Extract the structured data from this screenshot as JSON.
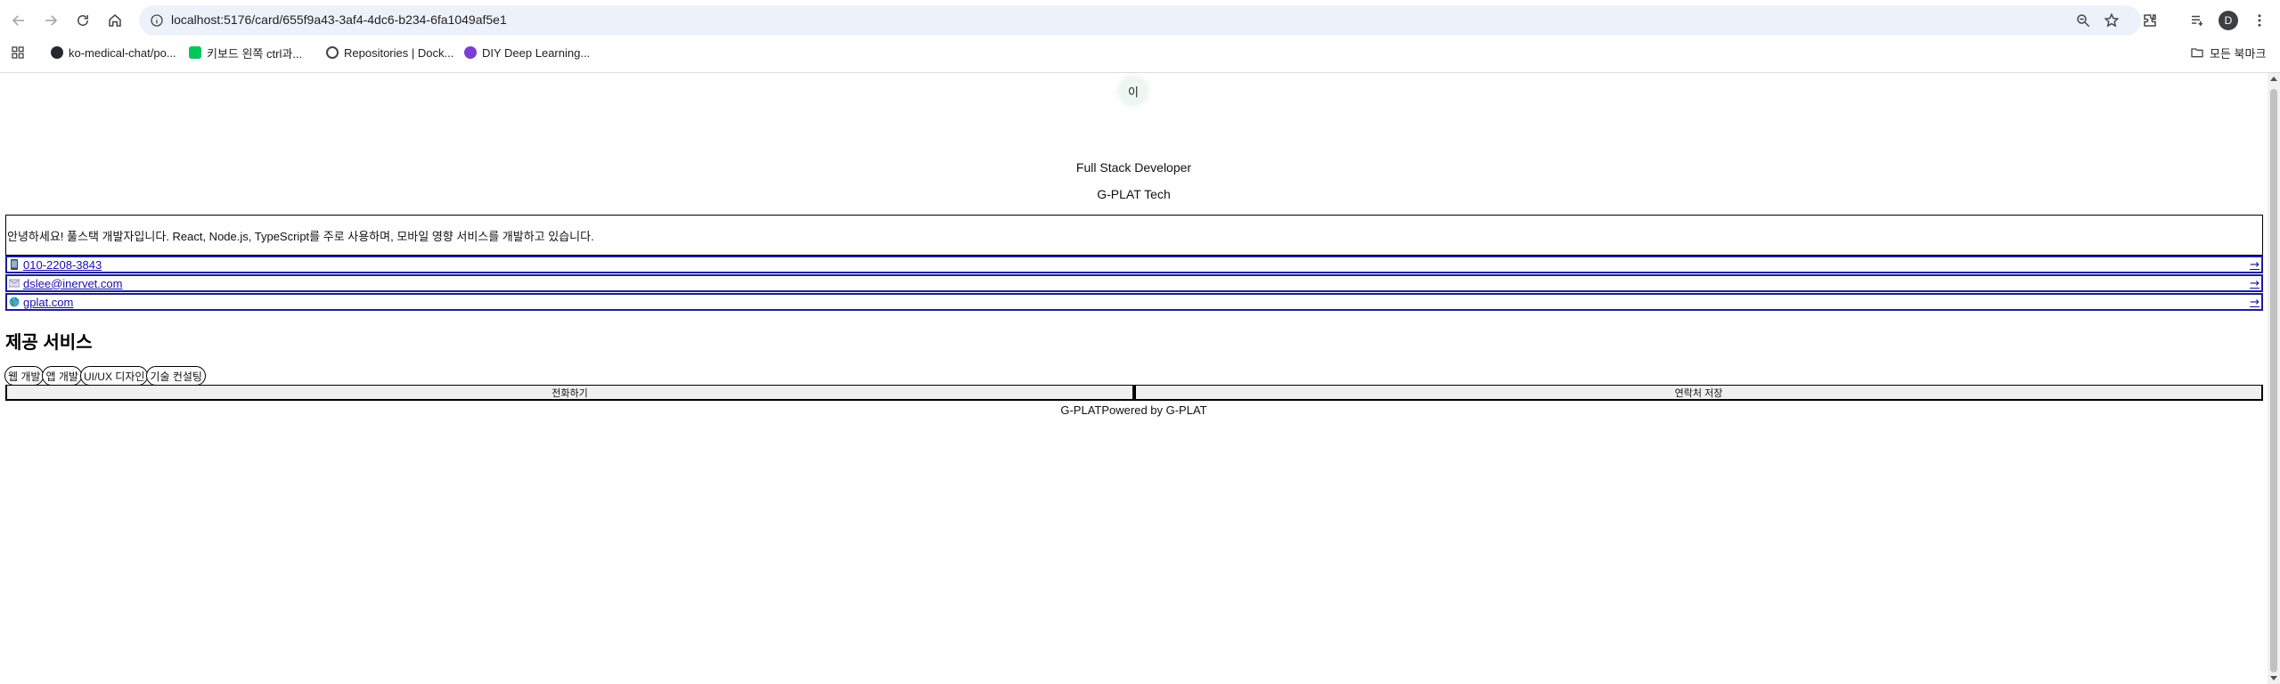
{
  "browser": {
    "url": "localhost:5176/card/655f9a43-3af4-4dc6-b234-6fa1049af5e1",
    "profile_initial": "D",
    "bookmarks": [
      {
        "label": "ko-medical-chat/po...",
        "icon": "github-icon",
        "color": "#24292f"
      },
      {
        "label": "키보드 왼쪽 ctrl과...",
        "icon": "naver-talk-icon",
        "color": "#03c75a"
      },
      {
        "label": "Repositories | Dock...",
        "icon": "docker-icon",
        "color": "#1d63ed"
      },
      {
        "label": "DIY Deep Learning...",
        "icon": "caffe-icon",
        "color": "#7b3fd0"
      }
    ],
    "all_bookmarks_label": "모든 북마크"
  },
  "card": {
    "avatar_initial": "이",
    "job_title": "Full Stack Developer",
    "company": "G-PLAT Tech",
    "intro": "안녕하세요! 풀스택 개발자입니다. React, Node.js, TypeScript를 주로 사용하며, 모바일 영향 서비스를 개발하고 있습니다.",
    "contacts": [
      {
        "type": "phone",
        "icon": "phone-icon",
        "text": "010-2208-3843",
        "arrow": "→"
      },
      {
        "type": "email",
        "icon": "email-icon",
        "text": "dslee@inervet.com",
        "arrow": "→"
      },
      {
        "type": "website",
        "icon": "globe-icon",
        "text": "gplat.com",
        "arrow": "→"
      }
    ],
    "services_title": "제공 서비스",
    "services": [
      "웹 개발",
      "앱 개발",
      "UI/UX 디자인",
      "기술 컨설팅"
    ],
    "actions": {
      "call": "전화하기",
      "save_contact": "연락처 저장"
    },
    "footer": {
      "logo_alt": "G-PLAT",
      "powered_by": "Powered by G-PLAT"
    }
  },
  "colors": {
    "link": "#1a0dab",
    "contact_border": "#1c1c9c",
    "omnibox_bg": "#edf2fa"
  }
}
